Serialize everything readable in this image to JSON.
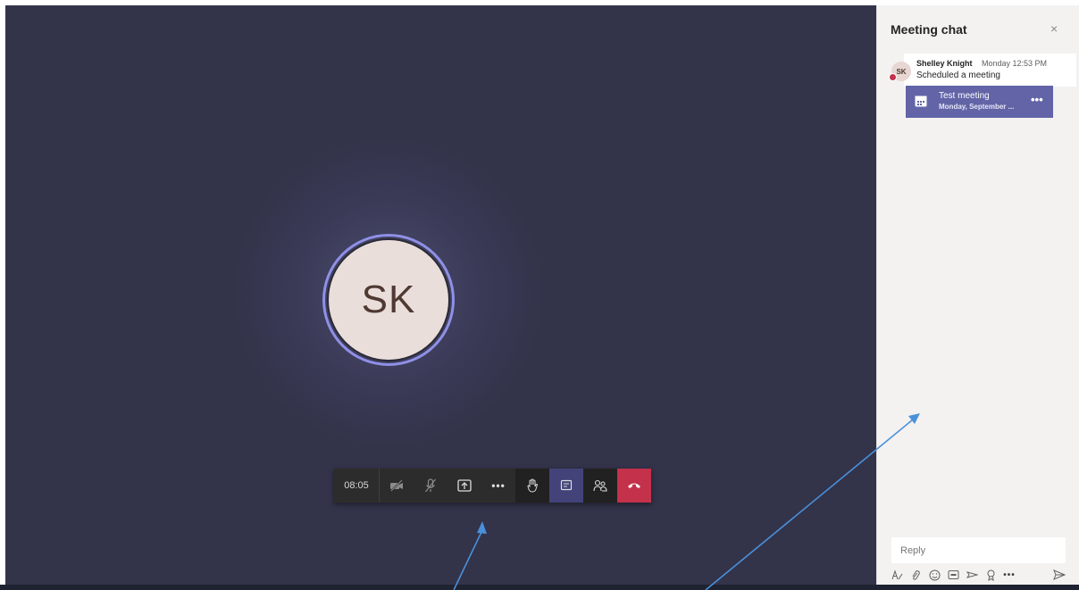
{
  "stage": {
    "avatar_initials": "SK",
    "toolbar": {
      "timer": "08:05",
      "video_icon": "video-off-icon",
      "mic_icon": "mic-off-icon",
      "share_icon": "share-screen-icon",
      "more_icon": "more-actions-icon",
      "more_label": "•••",
      "hand_icon": "raise-hand-icon",
      "chat_icon": "chat-icon",
      "people_icon": "participants-icon",
      "hangup_icon": "hang-up-icon"
    }
  },
  "chat_panel": {
    "title": "Meeting chat",
    "close_label": "×",
    "message": {
      "avatar_initials": "SK",
      "author": "Shelley Knight",
      "time": "Monday 12:53 PM",
      "text": "Scheduled a meeting",
      "card": {
        "title": "Test meeting",
        "date": "Monday, September ...",
        "more_label": "•••"
      }
    },
    "reply_placeholder": "Reply",
    "compose_icons": [
      "format-icon",
      "attach-icon",
      "emoji-icon",
      "gif-icon",
      "sticker-icon",
      "praise-icon",
      "more-options-icon",
      "send-icon"
    ],
    "more_label": "•••"
  },
  "colors": {
    "stage_bg": "#33334a",
    "avatar_ring": "#8f90e6",
    "avatar_fill": "#eadeda",
    "accent": "#6264a7",
    "hangup": "#c4314b",
    "annotation_arrow": "#4a90d9"
  }
}
